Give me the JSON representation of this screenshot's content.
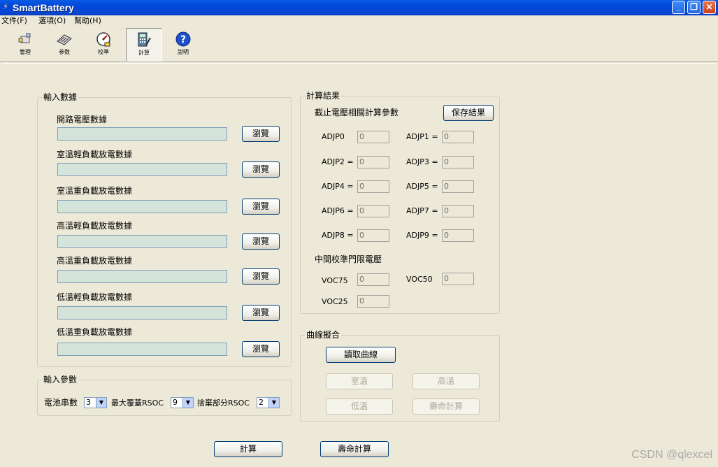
{
  "window": {
    "title": "SmartBattery",
    "controls": {
      "minimize": "_",
      "restore": "❐",
      "close": "✕"
    }
  },
  "menu": [
    "文件(F)",
    "選項(O)",
    "幫助(H)"
  ],
  "toolbar": [
    {
      "label": "管理",
      "icon": "manage-icon"
    },
    {
      "label": "参数",
      "icon": "chip-icon"
    },
    {
      "label": "校準",
      "icon": "gauge-icon"
    },
    {
      "label": "計算",
      "icon": "calculator-icon",
      "pressed": true
    },
    {
      "label": "說明",
      "icon": "help-icon"
    }
  ],
  "input_data": {
    "title": "輸入數據",
    "browse_label": "瀏覽",
    "fields": [
      {
        "label": "開路電壓數據",
        "value": ""
      },
      {
        "label": "室溫輕負載放電數據",
        "value": ""
      },
      {
        "label": "室溫重負載放電數據",
        "value": ""
      },
      {
        "label": "高溫輕負載放電數據",
        "value": ""
      },
      {
        "label": "高溫重負載放電數據",
        "value": ""
      },
      {
        "label": "低溫輕負載放電數據",
        "value": ""
      },
      {
        "label": "低溫重負載放電數據",
        "value": ""
      }
    ]
  },
  "input_params": {
    "title": "輸入參數",
    "cells_label": "電池串數",
    "cells_value": "3",
    "max_rsoc_label": "最大覆蓋RSOC",
    "max_rsoc_value": "9",
    "discard_rsoc_label": "捨棄部分RSOC",
    "discard_rsoc_value": "2"
  },
  "results": {
    "title": "計算結果",
    "subtitle": "截止電壓相關計算參數",
    "save_label": "保存結果",
    "adjp": [
      {
        "label": "ADJP0",
        "value": "0"
      },
      {
        "label": "ADJP1 =",
        "value": "0"
      },
      {
        "label": "ADJP2 =",
        "value": "0"
      },
      {
        "label": "ADJP3 =",
        "value": "0"
      },
      {
        "label": "ADJP4 =",
        "value": "0"
      },
      {
        "label": "ADJP5 =",
        "value": "0"
      },
      {
        "label": "ADJP6 =",
        "value": "0"
      },
      {
        "label": "ADJP7 =",
        "value": "0"
      },
      {
        "label": "ADJP8 =",
        "value": "0"
      },
      {
        "label": "ADJP9 =",
        "value": "0"
      }
    ],
    "threshold_title": "中間校準門限電壓",
    "voc": [
      {
        "label": "VOC75",
        "value": "0"
      },
      {
        "label": "VOC50",
        "value": "0"
      },
      {
        "label": "VOC25",
        "value": "0"
      }
    ]
  },
  "curve_fit": {
    "title": "曲線擬合",
    "read_label": "讀取曲線",
    "room_label": "室溫",
    "high_label": "高溫",
    "low_label": "低溫",
    "life_label": "壽命計算"
  },
  "bottom": {
    "calc_label": "計算",
    "life_label": "壽命計算"
  },
  "watermark": "CSDN @qlexcel",
  "colors": {
    "titlebar": "#0a5be6",
    "face": "#ece9d8",
    "field_bg": "#d5e4da",
    "button_border": "#003c74"
  }
}
